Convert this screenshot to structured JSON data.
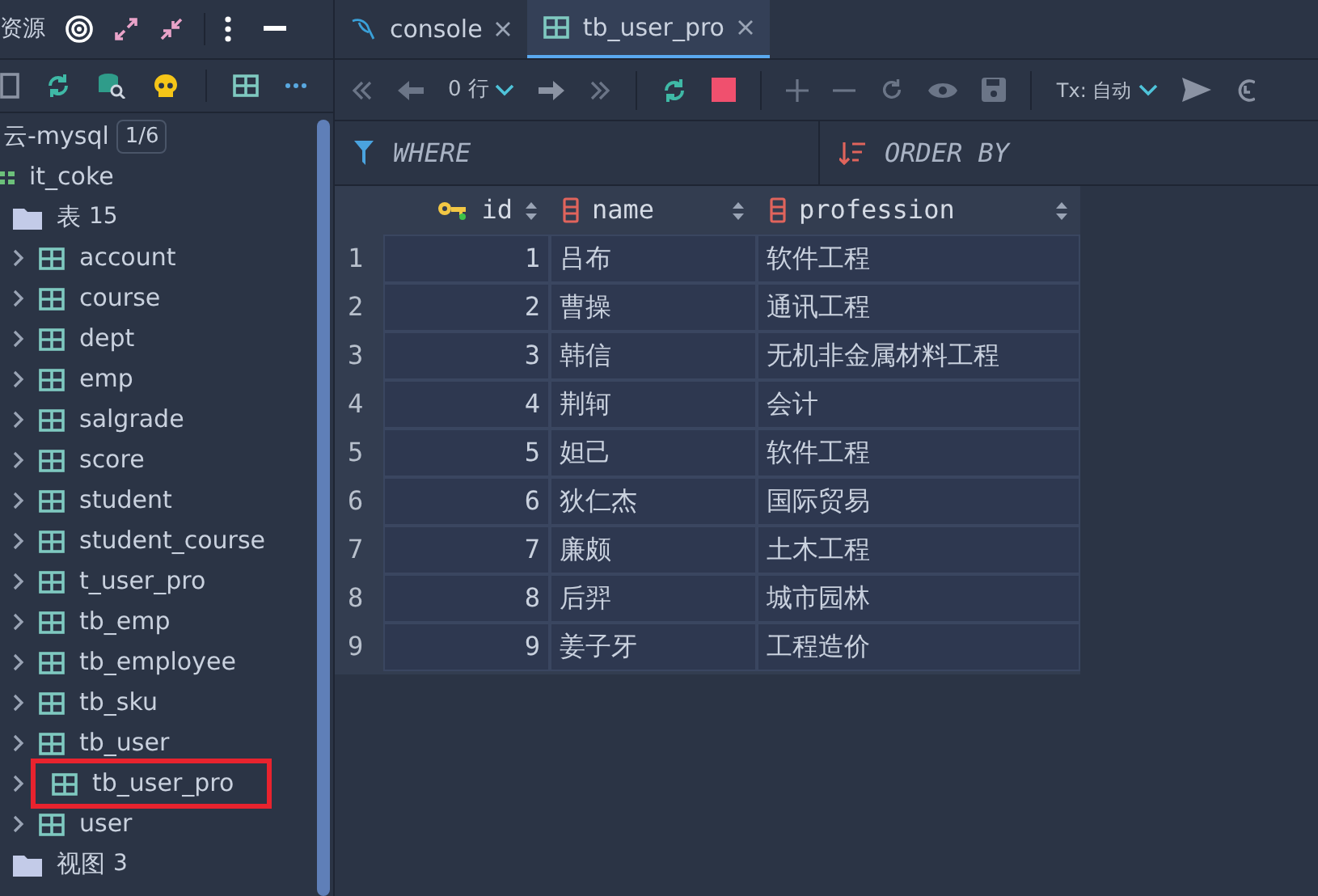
{
  "sidebar": {
    "header": {
      "title": "资源"
    },
    "tree": [
      {
        "label": "云-mysql",
        "badge": "1/6",
        "kind": "connection",
        "children": [
          {
            "label": "it_coke",
            "kind": "schema",
            "children": [
              {
                "label": "表",
                "count": "15",
                "kind": "folder",
                "children": [
                  {
                    "label": "account",
                    "kind": "table",
                    "expanded": false,
                    "highlighted": false
                  },
                  {
                    "label": "course",
                    "kind": "table",
                    "expanded": false,
                    "highlighted": false
                  },
                  {
                    "label": "dept",
                    "kind": "table",
                    "expanded": false,
                    "highlighted": false
                  },
                  {
                    "label": "emp",
                    "kind": "table",
                    "expanded": false,
                    "highlighted": false
                  },
                  {
                    "label": "salgrade",
                    "kind": "table",
                    "expanded": false,
                    "highlighted": false
                  },
                  {
                    "label": "score",
                    "kind": "table",
                    "expanded": false,
                    "highlighted": false
                  },
                  {
                    "label": "student",
                    "kind": "table",
                    "expanded": false,
                    "highlighted": false
                  },
                  {
                    "label": "student_course",
                    "kind": "table",
                    "expanded": false,
                    "highlighted": false
                  },
                  {
                    "label": "t_user_pro",
                    "kind": "table",
                    "expanded": false,
                    "highlighted": false
                  },
                  {
                    "label": "tb_emp",
                    "kind": "table",
                    "expanded": false,
                    "highlighted": false
                  },
                  {
                    "label": "tb_employee",
                    "kind": "table",
                    "expanded": false,
                    "highlighted": false
                  },
                  {
                    "label": "tb_sku",
                    "kind": "table",
                    "expanded": false,
                    "highlighted": false
                  },
                  {
                    "label": "tb_user",
                    "kind": "table",
                    "expanded": false,
                    "highlighted": false
                  },
                  {
                    "label": "tb_user_pro",
                    "kind": "table",
                    "expanded": false,
                    "highlighted": true
                  },
                  {
                    "label": "user",
                    "kind": "table",
                    "expanded": false,
                    "highlighted": false
                  }
                ]
              },
              {
                "label": "视图",
                "count": "3",
                "kind": "folder"
              }
            ]
          }
        ]
      }
    ]
  },
  "tabs": [
    {
      "label": "console",
      "kind": "console",
      "selected": false
    },
    {
      "label": "tb_user_pro",
      "kind": "table",
      "selected": true
    }
  ],
  "toolbar": {
    "rows": "0 行",
    "tx": "Tx: 自动"
  },
  "filter": {
    "where": "WHERE",
    "order_by": "ORDER BY"
  },
  "table": {
    "columns": [
      {
        "label": "id",
        "kind": "key"
      },
      {
        "label": "name",
        "kind": "column"
      },
      {
        "label": "profession",
        "kind": "column"
      }
    ],
    "rows": [
      {
        "n": "1",
        "cells": [
          "1",
          "吕布",
          "软件工程"
        ]
      },
      {
        "n": "2",
        "cells": [
          "2",
          "曹操",
          "通讯工程"
        ]
      },
      {
        "n": "3",
        "cells": [
          "3",
          "韩信",
          "无机非金属材料工程"
        ]
      },
      {
        "n": "4",
        "cells": [
          "4",
          "荆轲",
          "会计"
        ]
      },
      {
        "n": "5",
        "cells": [
          "5",
          "妲己",
          "软件工程"
        ]
      },
      {
        "n": "6",
        "cells": [
          "6",
          "狄仁杰",
          "国际贸易"
        ]
      },
      {
        "n": "7",
        "cells": [
          "7",
          "廉颇",
          "土木工程"
        ]
      },
      {
        "n": "8",
        "cells": [
          "8",
          "后羿",
          "城市园林"
        ]
      },
      {
        "n": "9",
        "cells": [
          "9",
          "姜子牙",
          "工程造价"
        ]
      }
    ]
  }
}
